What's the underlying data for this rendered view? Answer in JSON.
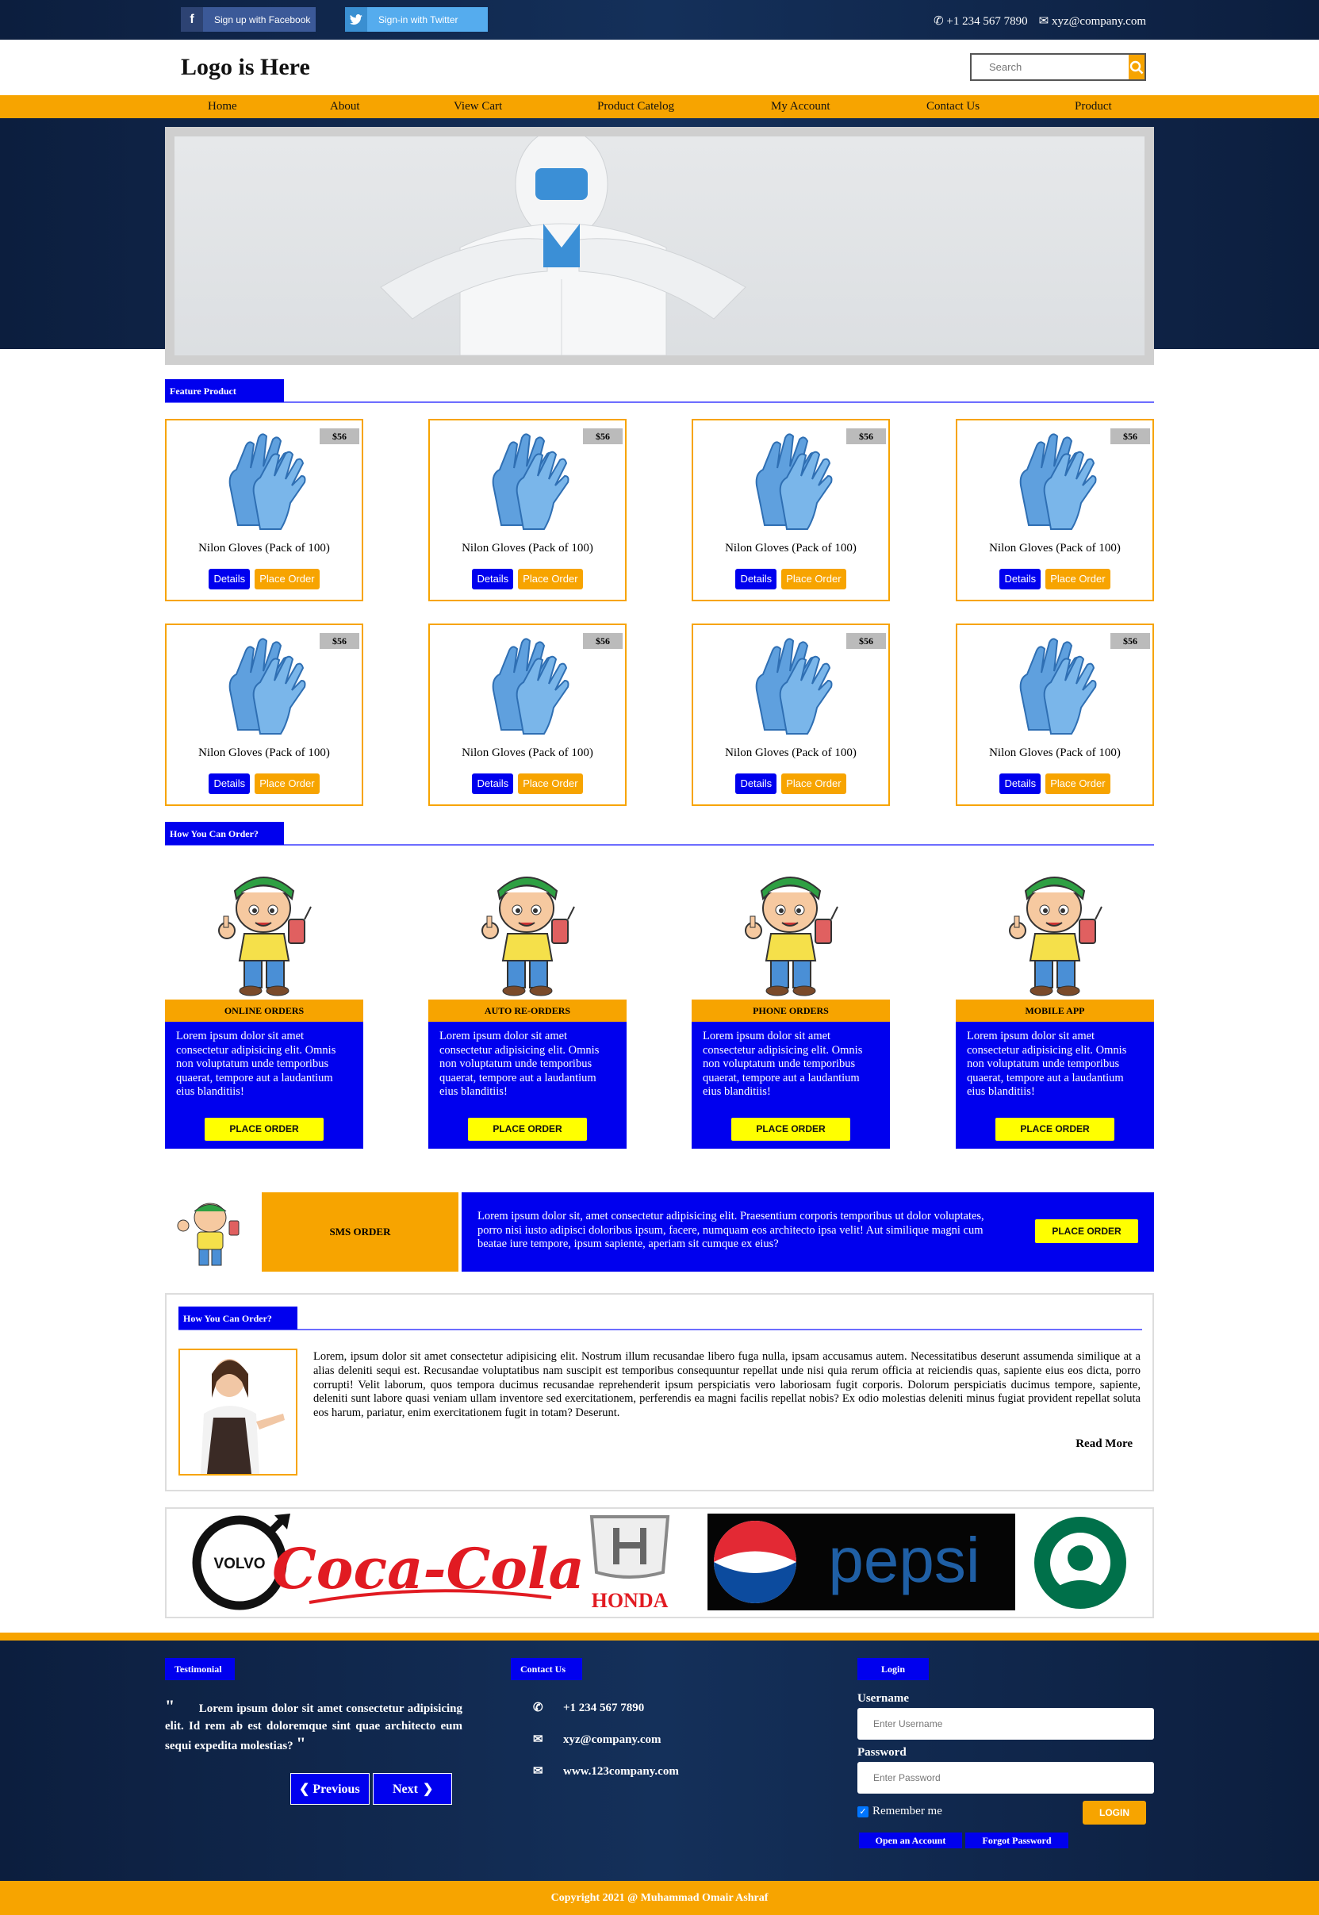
{
  "topbar": {
    "facebook_label": "Sign up with Facebook",
    "twitter_label": "Sign-in with Twitter",
    "phone": "+1 234 567 7890",
    "email": "xyz@company.com"
  },
  "header": {
    "logo": "Logo is Here",
    "search_placeholder": "Search"
  },
  "nav": [
    "Home",
    "About",
    "View Cart",
    "Product Catelog",
    "My Account",
    "Contact Us",
    "Product"
  ],
  "featured": {
    "title": "Feature Product",
    "products": [
      {
        "name": "Nilon Gloves (Pack of 100)",
        "price": "$56",
        "details": "Details",
        "order": "Place Order"
      },
      {
        "name": "Nilon Gloves (Pack of 100)",
        "price": "$56",
        "details": "Details",
        "order": "Place Order"
      },
      {
        "name": "Nilon Gloves (Pack of 100)",
        "price": "$56",
        "details": "Details",
        "order": "Place Order"
      },
      {
        "name": "Nilon Gloves (Pack of 100)",
        "price": "$56",
        "details": "Details",
        "order": "Place Order"
      },
      {
        "name": "Nilon Gloves (Pack of 100)",
        "price": "$56",
        "details": "Details",
        "order": "Place Order"
      },
      {
        "name": "Nilon Gloves (Pack of 100)",
        "price": "$56",
        "details": "Details",
        "order": "Place Order"
      },
      {
        "name": "Nilon Gloves (Pack of 100)",
        "price": "$56",
        "details": "Details",
        "order": "Place Order"
      },
      {
        "name": "Nilon Gloves (Pack of 100)",
        "price": "$56",
        "details": "Details",
        "order": "Place Order"
      }
    ]
  },
  "howto": {
    "title": "How You Can Order?",
    "methods": [
      {
        "title": "ONLINE ORDERS",
        "text": "Lorem ipsum dolor sit amet consectetur adipisicing elit. Omnis non voluptatum unde temporibus quaerat, tempore aut a laudantium eius blanditiis!",
        "button": "PLACE ORDER"
      },
      {
        "title": "AUTO RE-ORDERS",
        "text": "Lorem ipsum dolor sit amet consectetur adipisicing elit. Omnis non voluptatum unde temporibus quaerat, tempore aut a laudantium eius blanditiis!",
        "button": "PLACE ORDER"
      },
      {
        "title": "PHONE ORDERS",
        "text": "Lorem ipsum dolor sit amet consectetur adipisicing elit. Omnis non voluptatum unde temporibus quaerat, tempore aut a laudantium eius blanditiis!",
        "button": "PLACE ORDER"
      },
      {
        "title": "MOBILE APP",
        "text": "Lorem ipsum dolor sit amet consectetur adipisicing elit. Omnis non voluptatum unde temporibus quaerat, tempore aut a laudantium eius blanditiis!",
        "button": "PLACE ORDER"
      }
    ],
    "sms": {
      "title": "SMS ORDER",
      "text": "Lorem ipsum dolor sit, amet consectetur adipisicing elit. Praesentium corporis temporibus ut dolor voluptates, porro nisi iusto adipisci doloribus ipsum, facere, numquam eos architecto ipsa velit! Aut similique magni cum beatae iure tempore, ipsum sapiente, aperiam sit cumque ex eius?",
      "button": "PLACE ORDER"
    }
  },
  "about": {
    "title": "How You Can Order?",
    "text": "Lorem, ipsum dolor sit amet consectetur adipisicing elit. Nostrum illum recusandae libero fuga nulla, ipsam accusamus autem. Necessitatibus deserunt assumenda similique at a alias deleniti sequi est. Recusandae voluptatibus nam suscipit est temporibus consequuntur repellat unde nisi quia rerum officia at reiciendis quas, sapiente eius eos dicta, porro corrupti! Velit laborum, quos tempora ducimus recusandae reprehenderit ipsum perspiciatis vero laboriosam fugit corporis. Dolorum perspiciatis ducimus tempore, sapiente, deleniti sunt labore quasi veniam ullam inventore sed exercitationem, perferendis ea magni facilis repellat nobis? Ex odio molestias deleniti minus fugiat provident repellat soluta eos harum, pariatur, enim exercitationem fugit in totam? Deserunt.",
    "read_more": "Read More"
  },
  "brands": [
    "VOLVO",
    "Coca-Cola",
    "HONDA",
    "pepsi",
    "Starbucks"
  ],
  "footer": {
    "testimonial_title": "Testimonial",
    "testimonial_text": "Lorem ipsum dolor sit amet consectetur adipisicing elit. Id rem ab est doloremque sint quae architecto eum sequi expedita molestias?",
    "prev": "Previous",
    "next": "Next",
    "contact_title": "Contact Us",
    "phone": "+1 234 567 7890",
    "email": "xyz@company.com",
    "website": "www.123company.com",
    "login_title": "Login",
    "username_label": "Username",
    "username_placeholder": "Enter Username",
    "password_label": "Password",
    "password_placeholder": "Enter Password",
    "remember": "Remember me",
    "login_button": "LOGIN",
    "open_account": "Open an Account",
    "forgot_password": "Forgot Password",
    "copyright": "Copyright 2021 @ Muhammad Omair Ashraf"
  },
  "colors": {
    "accent": "#f7a400",
    "primary": "#0000ee",
    "dark": "#0c1e3e",
    "highlight": "#ffff00"
  }
}
